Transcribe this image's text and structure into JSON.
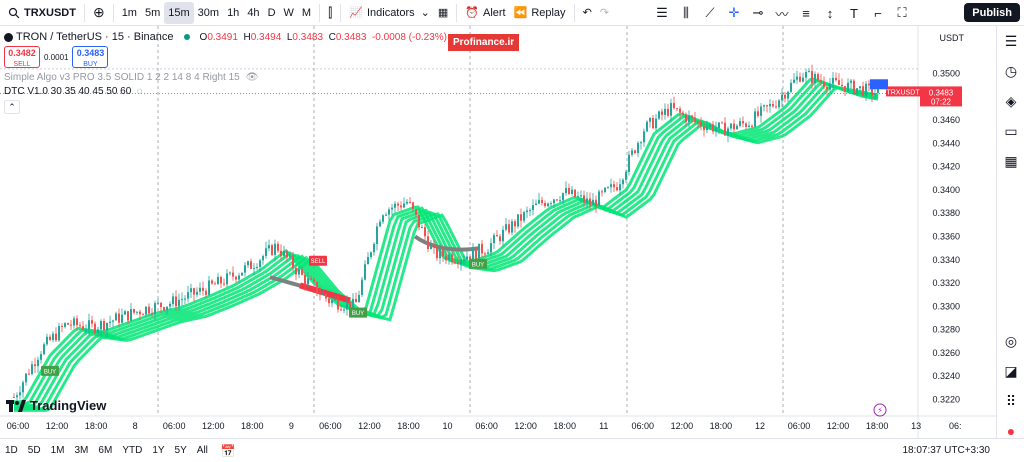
{
  "topbar": {
    "symbol": "TRXUSDT",
    "timeframes": [
      "1m",
      "5m",
      "15m",
      "30m",
      "1h",
      "4h",
      "D",
      "W",
      "M"
    ],
    "active_timeframe": "15m",
    "indicators_label": "Indicators",
    "alert_label": "Alert",
    "replay_label": "Replay",
    "publish_label": "Publish"
  },
  "legend": {
    "title": "TRON / TetherUS · 15 · Binance",
    "open_label": "O",
    "open": "0.3491",
    "high_label": "H",
    "high": "0.3494",
    "low_label": "L",
    "low": "0.3483",
    "close_label": "C",
    "close": "0.3483",
    "change": "-0.0008 (-0.23%)",
    "sell_price": "0.3482",
    "sell_label": "SELL",
    "spread": "0.0001",
    "buy_price": "0.3483",
    "buy_label": "BUY",
    "indicator_1": "Simple Algo v3 PRO 3.5 SOLID 1 2 2 14 8 4 Right 15",
    "indicator_2": "DTC V1.0 30 35 40 45 50 60"
  },
  "watermark": "Profinance.ir",
  "logo_text": "TradingView",
  "price_axis": {
    "currency": "USDT",
    "ticks": [
      "0.3500",
      "0.3480",
      "0.3460",
      "0.3440",
      "0.3420",
      "0.3400",
      "0.3380",
      "0.3360",
      "0.3340",
      "0.3320",
      "0.3300",
      "0.3280",
      "0.3260",
      "0.3240",
      "0.3220"
    ],
    "last_symbol": "TRXUSDT",
    "last_price": "0.3483",
    "countdown": "07:22"
  },
  "time_axis": {
    "ticks": [
      "06:00",
      "12:00",
      "18:00",
      "8",
      "06:00",
      "12:00",
      "18:00",
      "9",
      "06:00",
      "12:00",
      "18:00",
      "10",
      "06:00",
      "12:00",
      "18:00",
      "11",
      "06:00",
      "12:00",
      "18:00",
      "12",
      "06:00",
      "12:00",
      "18:00",
      "13",
      "06:"
    ]
  },
  "signals": [
    {
      "label": "BUY",
      "color": "#43a047"
    },
    {
      "label": "SELL",
      "color": "#f23645"
    },
    {
      "label": "BUY",
      "color": "#43a047"
    },
    {
      "label": "BUY",
      "color": "#43a047"
    }
  ],
  "bottombar": {
    "ranges": [
      "1D",
      "5D",
      "1M",
      "3M",
      "6M",
      "YTD",
      "1Y",
      "5Y",
      "All"
    ],
    "clock": "18:07:37 UTC+3:30"
  },
  "colors": {
    "up": "#26a69a",
    "down": "#ef5350",
    "ribbon": "#00e676",
    "accent": "#2962ff"
  },
  "chart_data": {
    "type": "candlestick",
    "price_series": [
      0.3222,
      0.3262,
      0.3285,
      0.3282,
      0.329,
      0.3298,
      0.3303,
      0.3312,
      0.3322,
      0.3335,
      0.3352,
      0.3325,
      0.3305,
      0.33,
      0.3382,
      0.339,
      0.3345,
      0.3342,
      0.335,
      0.337,
      0.3388,
      0.3398,
      0.3388,
      0.3405,
      0.3452,
      0.347,
      0.3458,
      0.3452,
      0.3458,
      0.3475,
      0.35,
      0.3492,
      0.3488,
      0.3483
    ]
  }
}
